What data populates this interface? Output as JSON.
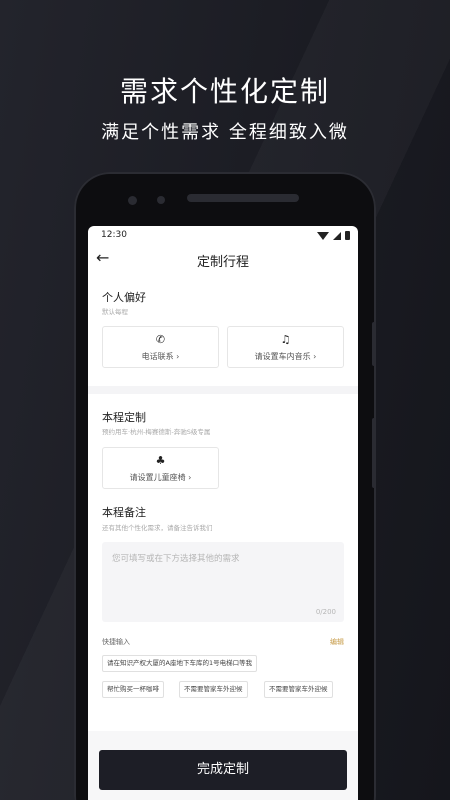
{
  "promo": {
    "headline": "需求个性化定制",
    "subline": "满足个性需求 全程细致入微"
  },
  "status_bar": {
    "time": "12:30"
  },
  "nav": {
    "back_icon": "←",
    "title": "定制行程"
  },
  "preferences": {
    "title": "个人偏好",
    "subtitle": "默认每程",
    "cards": [
      {
        "icon": "phone-icon",
        "glyph": "✆",
        "label": "电话联系 ›"
      },
      {
        "icon": "music-icon",
        "glyph": "♫",
        "label": "请设置车内音乐 ›"
      }
    ]
  },
  "trip": {
    "title": "本程定制",
    "subtitle": "预约用车·杭州-梅赛德斯-奔驰S级专属",
    "card": {
      "icon": "child-seat-icon",
      "glyph": "♣",
      "label": "请设置儿童座椅 ›"
    }
  },
  "notes": {
    "title": "本程备注",
    "subtitle": "还有其他个性化需求，请备注告诉我们",
    "placeholder": "您可填写或在下方选择其他的需求",
    "counter": "0/200"
  },
  "quick_input": {
    "label": "快捷输入",
    "edit_label": "编辑",
    "chips": [
      "请在知识产权大厦的A座地下车库的1号电梯口等我",
      "帮忙购买一杯咖啡",
      "不需要管家车外迎候",
      "不需要管家车外迎候"
    ]
  },
  "footer": {
    "done_label": "完成定制"
  },
  "colors": {
    "accent": "#c69a45",
    "button_dark": "#1d1e26",
    "background": "#1c1d24"
  }
}
